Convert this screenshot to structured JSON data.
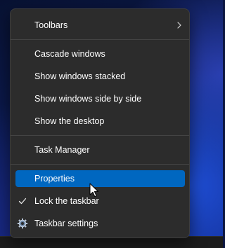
{
  "menu": {
    "toolbars": "Toolbars",
    "cascade": "Cascade windows",
    "stacked": "Show windows stacked",
    "side_by_side": "Show windows side by side",
    "desktop": "Show the desktop",
    "task_manager": "Task Manager",
    "properties": "Properties",
    "lock_taskbar": "Lock the taskbar",
    "lock_taskbar_checked": true,
    "taskbar_settings": "Taskbar settings",
    "selected_item": "properties"
  },
  "colors": {
    "menu_background": "#2c2c2c",
    "highlight": "#0067c0",
    "text": "#ffffff"
  },
  "icons": {
    "toolbars_submenu": "chevron-right-icon",
    "lock_check": "checkmark-icon",
    "settings": "gear-icon",
    "pointer": "mouse-cursor-icon"
  }
}
